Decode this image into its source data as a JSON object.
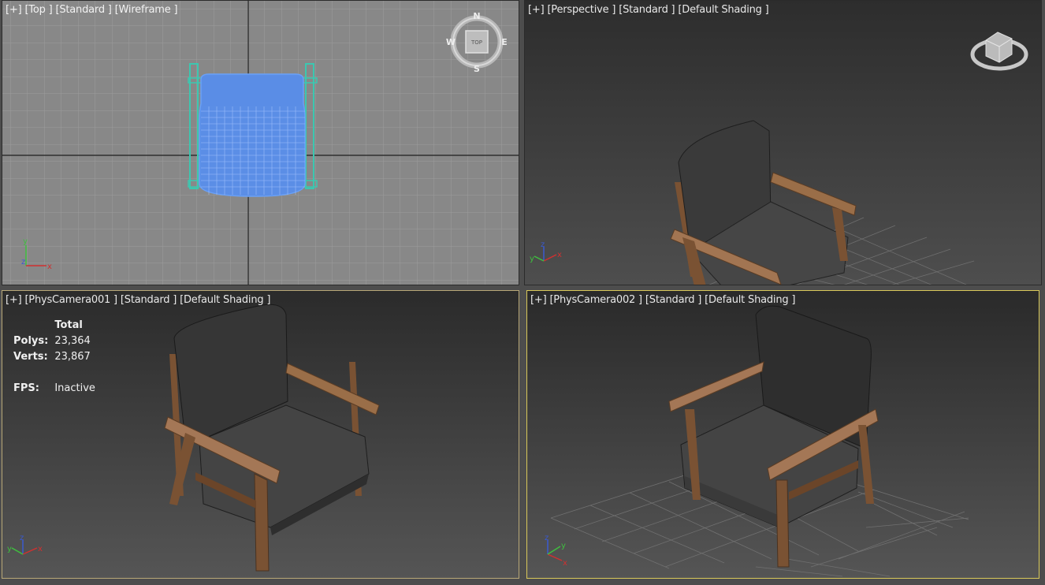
{
  "viewports": {
    "top": {
      "plus": "[+]",
      "view": "[Top ]",
      "preset": "[Standard ]",
      "shading": "[Wireframe ]",
      "viewcube": {
        "n": "N",
        "s": "S",
        "e": "E",
        "w": "W",
        "face": "TOP"
      }
    },
    "perspective": {
      "plus": "[+]",
      "view": "[Perspective ]",
      "preset": "[Standard ]",
      "shading": "[Default Shading ]"
    },
    "cam1": {
      "plus": "[+]",
      "view": "[PhysCamera001 ]",
      "preset": "[Standard ]",
      "shading": "[Default Shading ]"
    },
    "cam2": {
      "plus": "[+]",
      "view": "[PhysCamera002 ]",
      "preset": "[Standard ]",
      "shading": "[Default Shading ]"
    }
  },
  "stats": {
    "header": "Total",
    "polys_label": "Polys:",
    "polys_value": "23,364",
    "verts_label": "Verts:",
    "verts_value": "23,867",
    "fps_label": "FPS:",
    "fps_value": "Inactive"
  },
  "axis": {
    "x": "x",
    "y": "y",
    "z": "z"
  },
  "colors": {
    "wireframe": "#5b8ee6",
    "wire_frame_legs": "#3cc7b0",
    "cushion": "#3b3b3b",
    "wood": "#8a6040",
    "active_border": "#d9c95a"
  }
}
